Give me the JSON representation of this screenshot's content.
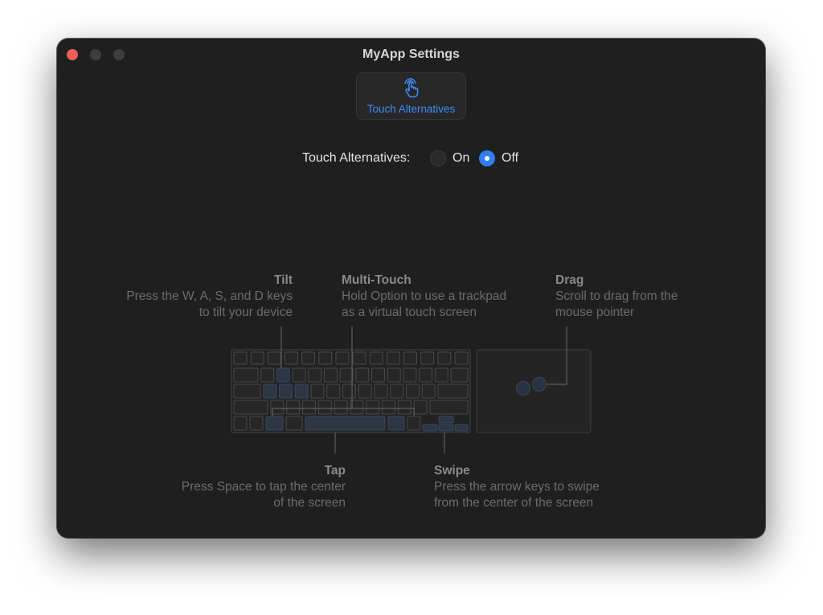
{
  "window": {
    "title": "MyApp Settings"
  },
  "toolbar": {
    "tab_label": "Touch Alternatives",
    "tab_icon": "hand-pointer-icon"
  },
  "setting": {
    "label": "Touch Alternatives:",
    "option_on": "On",
    "option_off": "Off",
    "selected": "Off"
  },
  "annotations": {
    "tilt": {
      "title": "Tilt",
      "line1": "Press the W, A, S, and D keys",
      "line2": "to tilt your device"
    },
    "multitouch": {
      "title": "Multi-Touch",
      "line1": "Hold Option to use a trackpad",
      "line2": "as a virtual touch screen"
    },
    "drag": {
      "title": "Drag",
      "line1": "Scroll to drag from the",
      "line2": "mouse pointer"
    },
    "tap": {
      "title": "Tap",
      "line1": "Press Space to tap the center",
      "line2": "of the screen"
    },
    "swipe": {
      "title": "Swipe",
      "line1": "Press the arrow keys to swipe",
      "line2": "from the center of the screen"
    }
  },
  "colors": {
    "accent": "#3b8ef7",
    "close": "#ec5e59",
    "key_highlight": "#2d3647"
  }
}
